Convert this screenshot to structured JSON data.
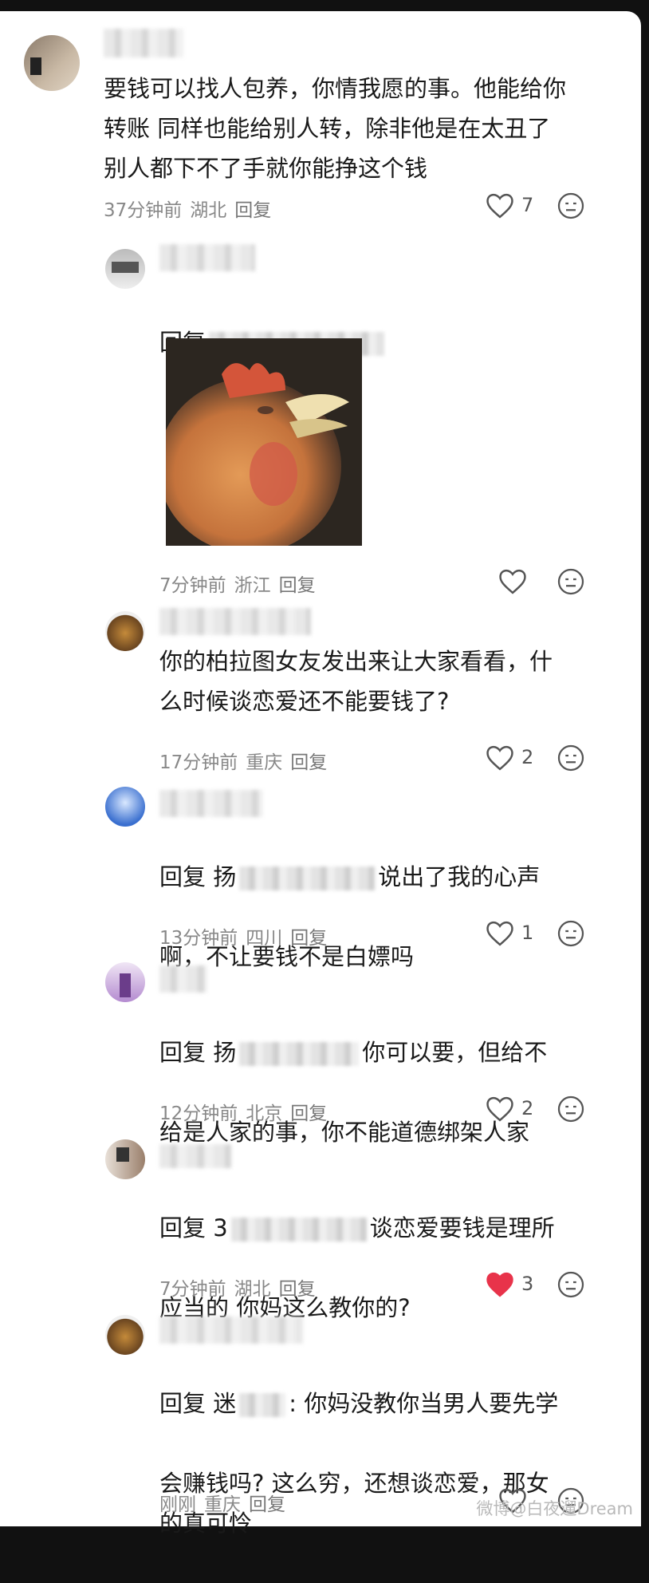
{
  "comments": [
    {
      "text": "要钱可以找人包养，你情我愿的事。他能给你\n转账 同样也能给别人转，除非他是在太丑了\n别人都下不了手就你能挣这个钱",
      "time": "37分钟前",
      "location": "湖北",
      "reply_label": "回复",
      "likes": "7"
    },
    {
      "reply_prefix": "回复",
      "image_alt": "rooster-image",
      "time": "7分钟前",
      "location": "浙江",
      "reply_label": "回复",
      "likes": ""
    },
    {
      "text": "你的柏拉图女友发出来让大家看看，什\n么时候谈恋爱还不能要钱了?",
      "time": "17分钟前",
      "location": "重庆",
      "reply_label": "回复",
      "likes": "2"
    },
    {
      "line1_a": "回复 扬",
      "line1_b": "说出了我的心声",
      "line2": "啊，不让要钱不是白嫖吗",
      "time": "13分钟前",
      "location": "四川",
      "reply_label": "回复",
      "likes": "1"
    },
    {
      "line1_a": "回复 扬",
      "line1_b": "你可以要，但给不",
      "line2": "给是人家的事，你不能道德绑架人家",
      "time": "12分钟前",
      "location": "北京",
      "reply_label": "回复",
      "likes": "2"
    },
    {
      "line1_a": "回复 3",
      "line1_b": "谈恋爱要钱是理所",
      "line2": "应当的 你妈这么教你的?",
      "time": "7分钟前",
      "location": "湖北",
      "reply_label": "回复",
      "likes": "3",
      "liked": true
    },
    {
      "line1_a": "回复 迷",
      "line1_b": ": 你妈没教你当男人要先学",
      "line2": "会赚钱吗? 这么穷，还想谈恋爱，那女\n的真可怜",
      "time": "刚刚",
      "location": "重庆",
      "reply_label": "回复",
      "likes": ""
    }
  ],
  "watermark": "微博@白夜遛Dream",
  "colors": {
    "liked": "#e8334a",
    "meta": "#888888",
    "text": "#1a1a1a"
  }
}
